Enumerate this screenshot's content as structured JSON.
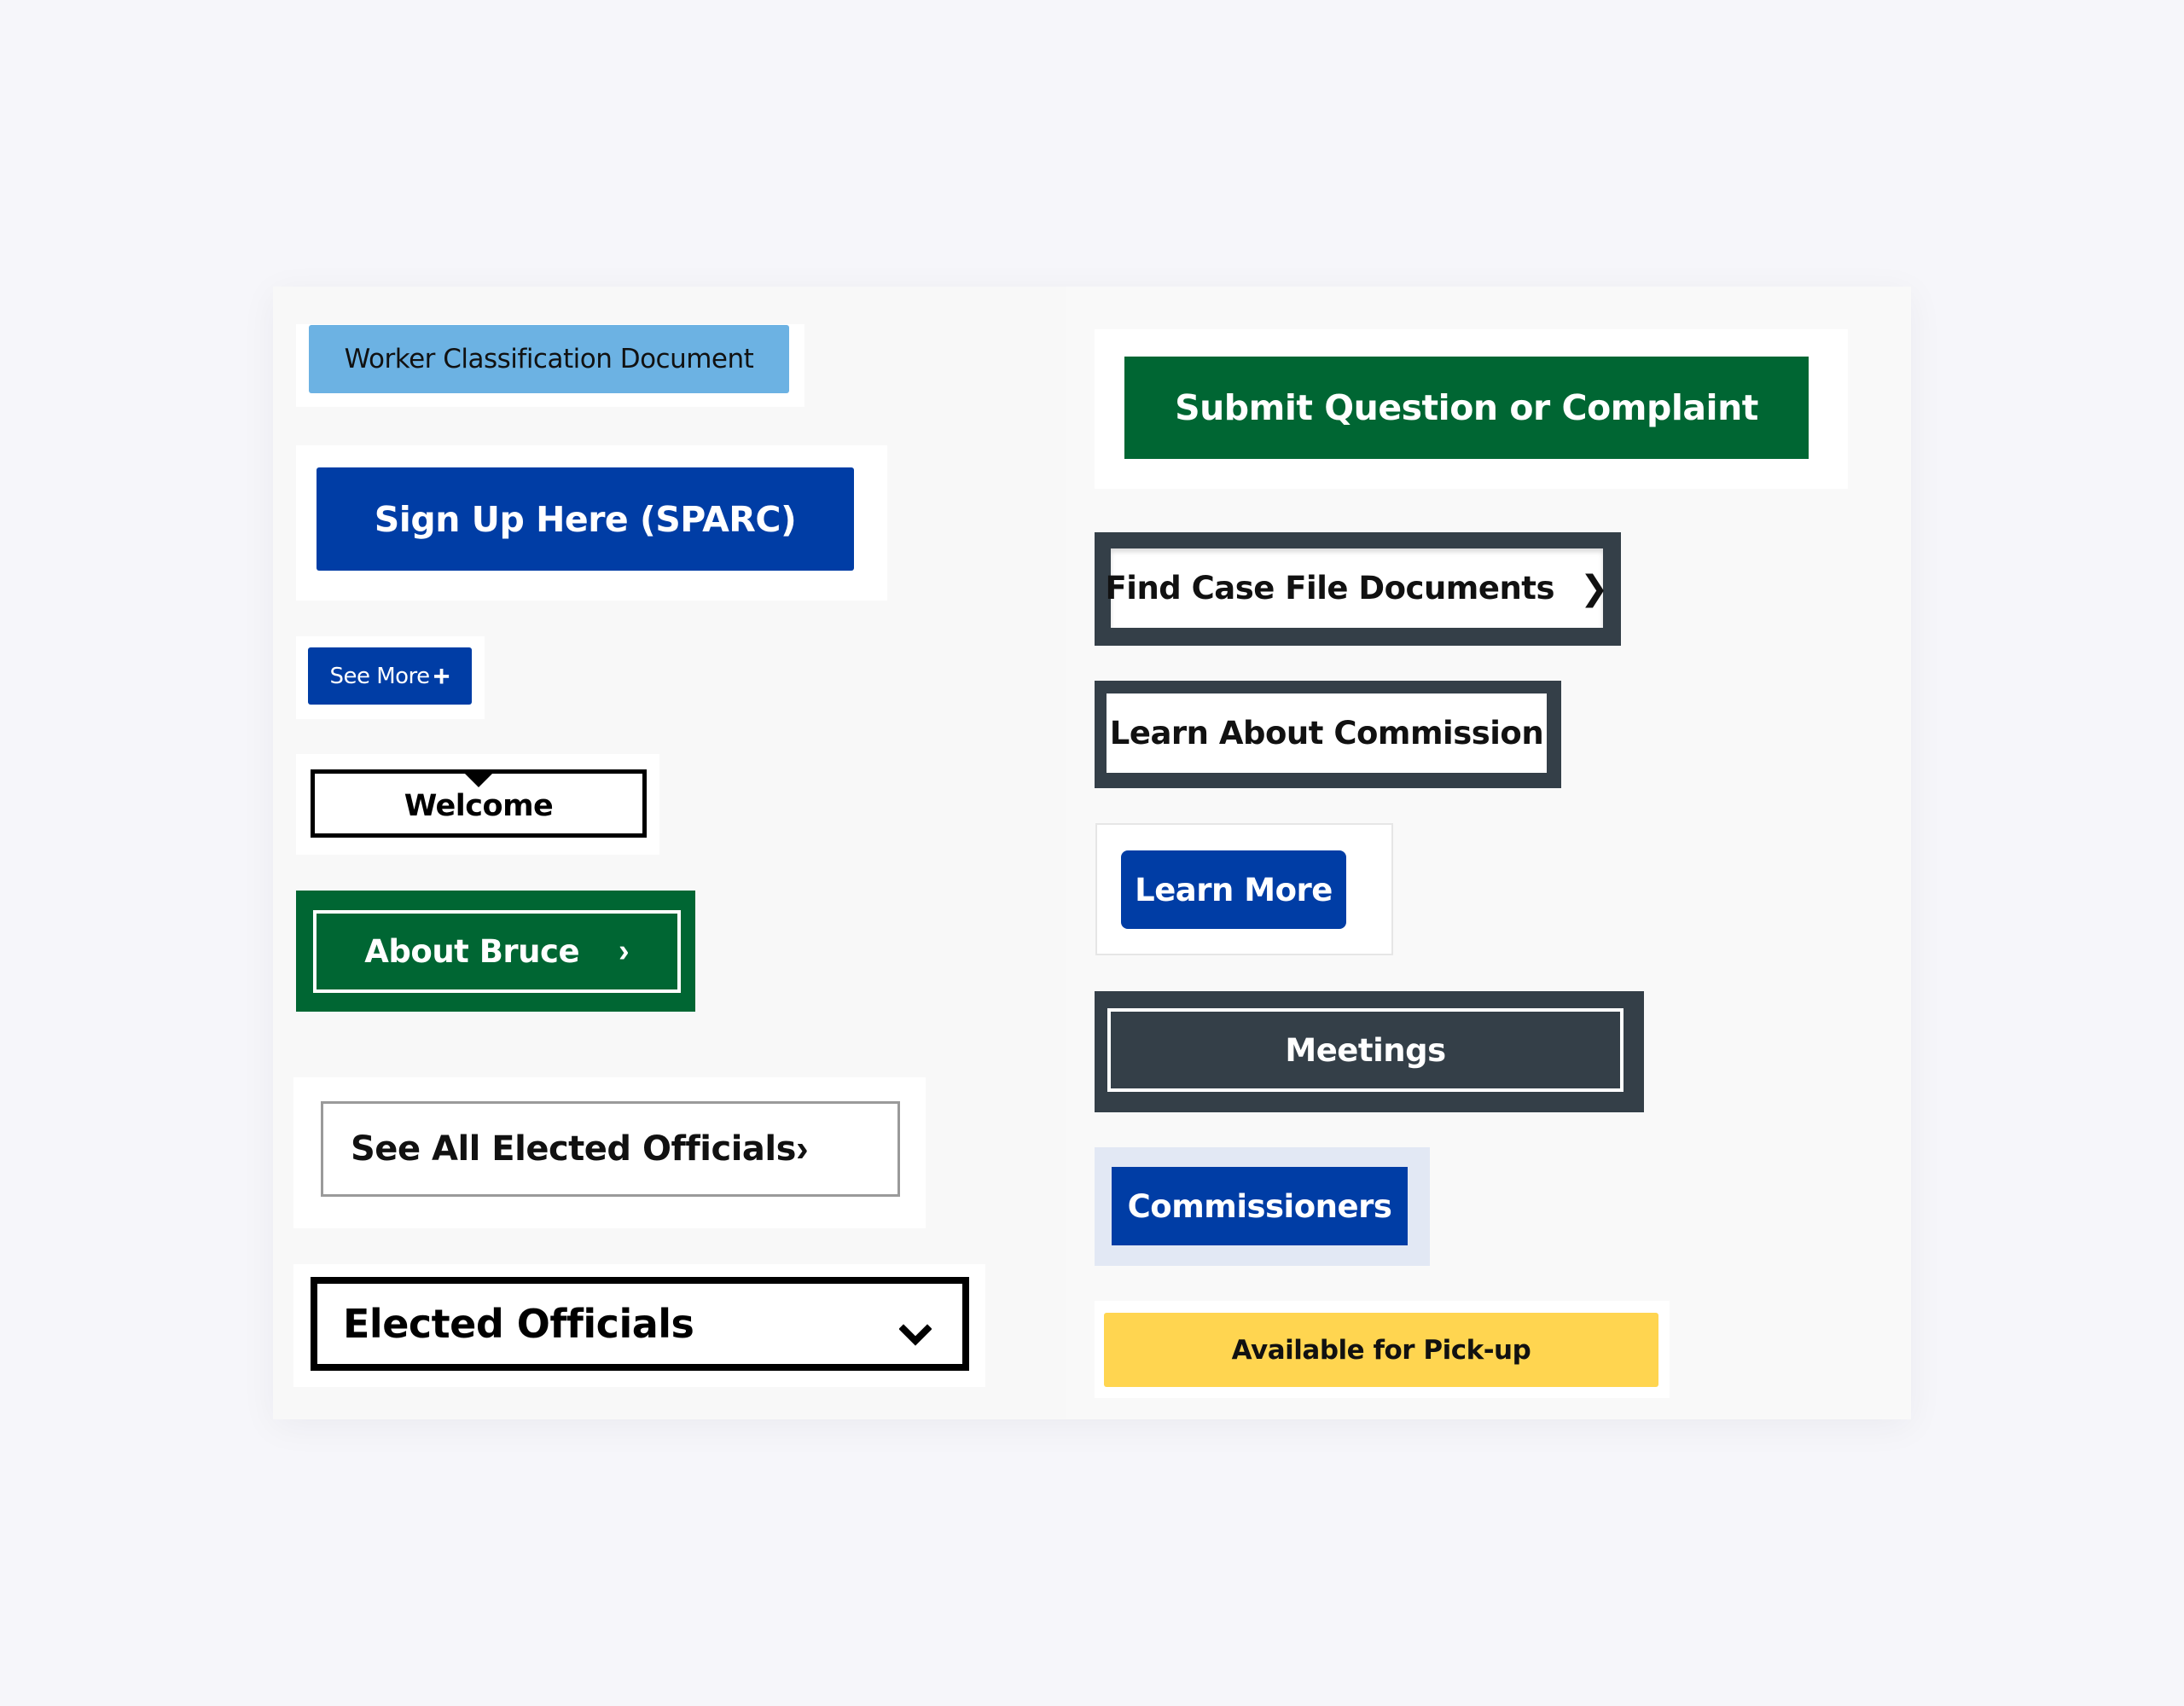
{
  "colors": {
    "page_background": "#f6f6fa",
    "card_background": "#f9f9f9",
    "light_blue": "#6cb2e3",
    "primary_blue": "#003da5",
    "green": "#006633",
    "slate": "#343f48",
    "light_blue_tint": "#e2e8f4",
    "yellow": "#ffd550"
  },
  "left_column": {
    "worker_classification": {
      "label": "Worker Classification Document"
    },
    "sign_up": {
      "label": "Sign Up Here (SPARC)"
    },
    "see_more": {
      "label": "See More",
      "icon": "plus-icon",
      "glyph": "+"
    },
    "welcome": {
      "label": "Welcome",
      "icon": "caret-down-icon"
    },
    "about_bruce": {
      "label": "About Bruce",
      "icon": "chevron-right-icon",
      "glyph": "›"
    },
    "see_all_elected": {
      "label": "See All Elected Officials",
      "icon": "chevron-right-icon",
      "glyph": "›"
    },
    "elected_officials": {
      "label": "Elected Officials",
      "icon": "chevron-down-icon"
    }
  },
  "right_column": {
    "submit_question": {
      "label": "Submit Question or Complaint"
    },
    "find_case_files": {
      "label": "Find Case File Documents",
      "icon": "chevron-right-icon",
      "glyph": "❯"
    },
    "learn_about_commission": {
      "label": "Learn About Commission"
    },
    "learn_more": {
      "label": "Learn More"
    },
    "meetings": {
      "label": "Meetings"
    },
    "commissioners": {
      "label": "Commissioners"
    },
    "available_pickup": {
      "label": "Available for Pick-up"
    }
  }
}
